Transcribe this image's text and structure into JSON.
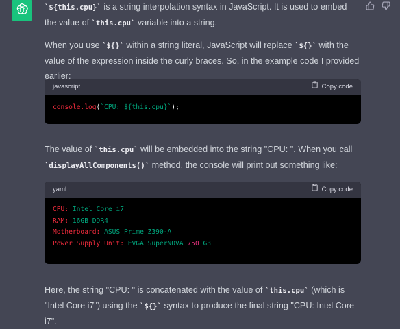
{
  "icons": {
    "avatar": "openai-logo-icon",
    "thumbs_up": "thumbs-up-icon",
    "thumbs_down": "thumbs-down-icon",
    "copy": "clipboard-icon"
  },
  "colors": {
    "background": "#444654",
    "avatar_bg": "#19c37d",
    "code_bg": "#000000",
    "code_header_bg": "#343541",
    "code_red": "#f22c3d",
    "code_green": "#00a67d"
  },
  "message": {
    "p1": {
      "code1": "`${this.cpu}`",
      "text1": " is a string interpolation syntax in JavaScript. It is used to embed the value of ",
      "code2": "`this.cpu`",
      "text2": " variable into a string."
    },
    "p2": {
      "text1": "When you use ",
      "code1": "`${}`",
      "text2": " within a string literal, JavaScript will replace ",
      "code2": "`${}`",
      "text3": " with the value of the expression inside the curly braces. So, in the example code I provided earlier:"
    },
    "code_block_1": {
      "language": "javascript",
      "copy_label": "Copy code",
      "line": {
        "fn": "console.log",
        "open": "(",
        "tmpl": "`CPU: ${this.cpu}`",
        "close": ");"
      }
    },
    "p3": {
      "text1": "The value of ",
      "code1": "`this.cpu`",
      "text2": " will be embedded into the string \"CPU: \". When you call ",
      "code2": "`displayAllComponents()`",
      "text3": " method, the console will print out something like:"
    },
    "code_block_2": {
      "language": "yaml",
      "copy_label": "Copy code",
      "lines": [
        {
          "key": "CPU:",
          "value": " Intel Core i7"
        },
        {
          "key": "RAM:",
          "value": " 16GB DDR4"
        },
        {
          "key": "Motherboard:",
          "value": " ASUS Prime Z390-A"
        },
        {
          "key": "Power Supply Unit:",
          "value_a": " EVGA SuperNOVA ",
          "value_num": "750",
          "value_b": " G3"
        }
      ]
    },
    "p4": {
      "text1": "Here, the string \"CPU: \" is concatenated with the value of ",
      "code1": "`this.cpu`",
      "text2": " (which is \"Intel Core i7\") using the ",
      "code2": "`${}`",
      "text3": " syntax to produce the final string \"CPU: Intel Core i7\"."
    }
  }
}
